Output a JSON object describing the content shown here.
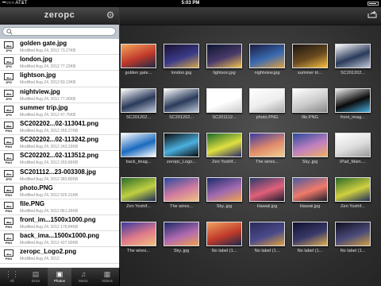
{
  "status_bar": {
    "carrier": "••○○○ AT&T",
    "time": "5:03 PM"
  },
  "left_panel": {
    "logo": "zeropc",
    "files": [
      {
        "name": "golden gate.jpg",
        "meta": "Modified Aug 24, 2012 73.27KB",
        "ext": "JPG"
      },
      {
        "name": "london.jpg",
        "meta": "Modified Aug 24, 2012 77.23KB",
        "ext": "JPG"
      },
      {
        "name": "lightson.jpg",
        "meta": "Modified Aug 24, 2012 83.19KB",
        "ext": "JPG"
      },
      {
        "name": "nightview.jpg",
        "meta": "Modified Aug 24, 2012 77.06KB",
        "ext": "JPG"
      },
      {
        "name": "summer trip.jpg",
        "meta": "Modified Aug 24, 2012 47.75KB",
        "ext": "JPG"
      },
      {
        "name": "SC202202...02-113041.png",
        "meta": "Modified Aug 24, 2012 265.27KB",
        "ext": "PNG"
      },
      {
        "name": "SC202202...02-113242.png",
        "meta": "Modified Aug 24, 2012 243.23KB",
        "ext": "PNG"
      },
      {
        "name": "SC202202...02-113512.png",
        "meta": "Modified Aug 24, 2012 265.86KB",
        "ext": "PNG"
      },
      {
        "name": "SC201112...23-003308.jpg",
        "meta": "Modified Aug 24, 2012 383.80KB",
        "ext": "JPG"
      },
      {
        "name": "photo.PNG",
        "meta": "Modified Aug 24, 2012 926.31KB",
        "ext": "PNG"
      },
      {
        "name": "file.PNG",
        "meta": "Modified Aug 24, 2012 861.35KB",
        "ext": "PNG"
      },
      {
        "name": "front_im...1500x1000.png",
        "meta": "Modified Aug 24, 2012 178.84KB",
        "ext": "PNG"
      },
      {
        "name": "back_ima...1500x1000.png",
        "meta": "Modified Aug 24, 2012 427.50KB",
        "ext": "PNG"
      },
      {
        "name": "zeropc_Logo2.png",
        "meta": "Modified Aug 24, 2012",
        "ext": "PNG"
      }
    ],
    "tabs": [
      {
        "icon": "⋮⋮",
        "label": "All"
      },
      {
        "icon": "▤",
        "label": "Docs"
      },
      {
        "icon": "▣",
        "label": "Photos",
        "active": true
      },
      {
        "icon": "♫",
        "label": "Music"
      },
      {
        "icon": "▦",
        "label": "Videos"
      }
    ]
  },
  "grid": {
    "thumbnails": [
      {
        "label": "golden gate...",
        "colors": [
          "#f5a45c",
          "#c0392b",
          "#1b2a45"
        ]
      },
      {
        "label": "london.jpg",
        "colors": [
          "#1a1030",
          "#3a3a8a",
          "#d4a64a"
        ]
      },
      {
        "label": "lightson.jpg",
        "colors": [
          "#0a1530",
          "#4a3a6a",
          "#f2c14e"
        ]
      },
      {
        "label": "nightview.jpg",
        "colors": [
          "#1a1a40",
          "#3a6ab0",
          "#e0a040"
        ]
      },
      {
        "label": "summer tri...",
        "colors": [
          "#1a1410",
          "#6a4a20",
          "#f4c040"
        ]
      },
      {
        "label": "SC201202...",
        "colors": [
          "#ffffff",
          "#2a3a5a",
          "#c0c8d8"
        ]
      },
      {
        "label": "SC201202...",
        "colors": [
          "#ffffff",
          "#2a3a5a",
          "#c0c8d8"
        ]
      },
      {
        "label": "SC201202...",
        "colors": [
          "#ffffff",
          "#2a3a5a",
          "#c0c8d8"
        ]
      },
      {
        "label": "SC201112...",
        "colors": [
          "#ffffff",
          "#ffffff",
          "#cccccc"
        ]
      },
      {
        "label": "photo.PNG",
        "colors": [
          "#ffffff",
          "#eeeeee",
          "#aaaaaa"
        ]
      },
      {
        "label": "file.PNG",
        "colors": [
          "#ffffff",
          "#cccccc",
          "#888888"
        ]
      },
      {
        "label": "front_imag...",
        "colors": [
          "#f0f0f0",
          "#0a0a0a",
          "#4ab0e0"
        ]
      },
      {
        "label": "back_imag...",
        "colors": [
          "#ffffff",
          "#1a6abf",
          "#ffffff"
        ]
      },
      {
        "label": "zeropc_Logo...",
        "colors": [
          "#0a0a0a",
          "#4ab0e0",
          "#0a0a0a"
        ]
      },
      {
        "label": "Zen Yoshif...",
        "colors": [
          "#1a6a2a",
          "#e0e040",
          "#2a2a6a"
        ]
      },
      {
        "label": "The wires...",
        "colors": [
          "#3a3aa0",
          "#e08a6a",
          "#f0d090"
        ]
      },
      {
        "label": "Sky..jpg",
        "colors": [
          "#2a4a9a",
          "#c080c0",
          "#f0b060"
        ]
      },
      {
        "label": "iPad_Main....",
        "colors": [
          "#ffffff",
          "#dddddd",
          "#999999"
        ]
      },
      {
        "label": "Zen Yoshif...",
        "colors": [
          "#2a6a2a",
          "#c0d040",
          "#1a2a5a"
        ]
      },
      {
        "label": "The wires...",
        "colors": [
          "#2a4aa0",
          "#d07aa0",
          "#f0c080"
        ]
      },
      {
        "label": "Sky..jpg",
        "colors": [
          "#1a2a6a",
          "#a06ab0",
          "#f0a050"
        ]
      },
      {
        "label": "Hawaii.jpg",
        "colors": [
          "#2a3a6a",
          "#e0607a",
          "#1a1a2a"
        ]
      },
      {
        "label": "Hawaii.jpg",
        "colors": [
          "#4a5aa0",
          "#f07a6a",
          "#1a1a2a"
        ]
      },
      {
        "label": "Zen Yoshif...",
        "colors": [
          "#2a6a2a",
          "#d0d040",
          "#1a2a5a"
        ]
      },
      {
        "label": "The wires...",
        "colors": [
          "#3a3aa0",
          "#e07a8a",
          "#f0c080"
        ]
      },
      {
        "label": "Sky..jpg",
        "colors": [
          "#1a2a6a",
          "#b06ab0",
          "#f0a050"
        ]
      },
      {
        "label": "No label (1...",
        "colors": [
          "#f0a060",
          "#c03a2a",
          "#1a2a4a"
        ]
      },
      {
        "label": "No label (1...",
        "colors": [
          "#2a2a5a",
          "#4a4a8a",
          "#e0a040"
        ]
      },
      {
        "label": "No label (1...",
        "colors": [
          "#101030",
          "#3a3a6a",
          "#e0b050"
        ]
      },
      {
        "label": "No label (1...",
        "colors": [
          "#101020",
          "#4a4a7a",
          "#d0a040"
        ]
      }
    ]
  }
}
